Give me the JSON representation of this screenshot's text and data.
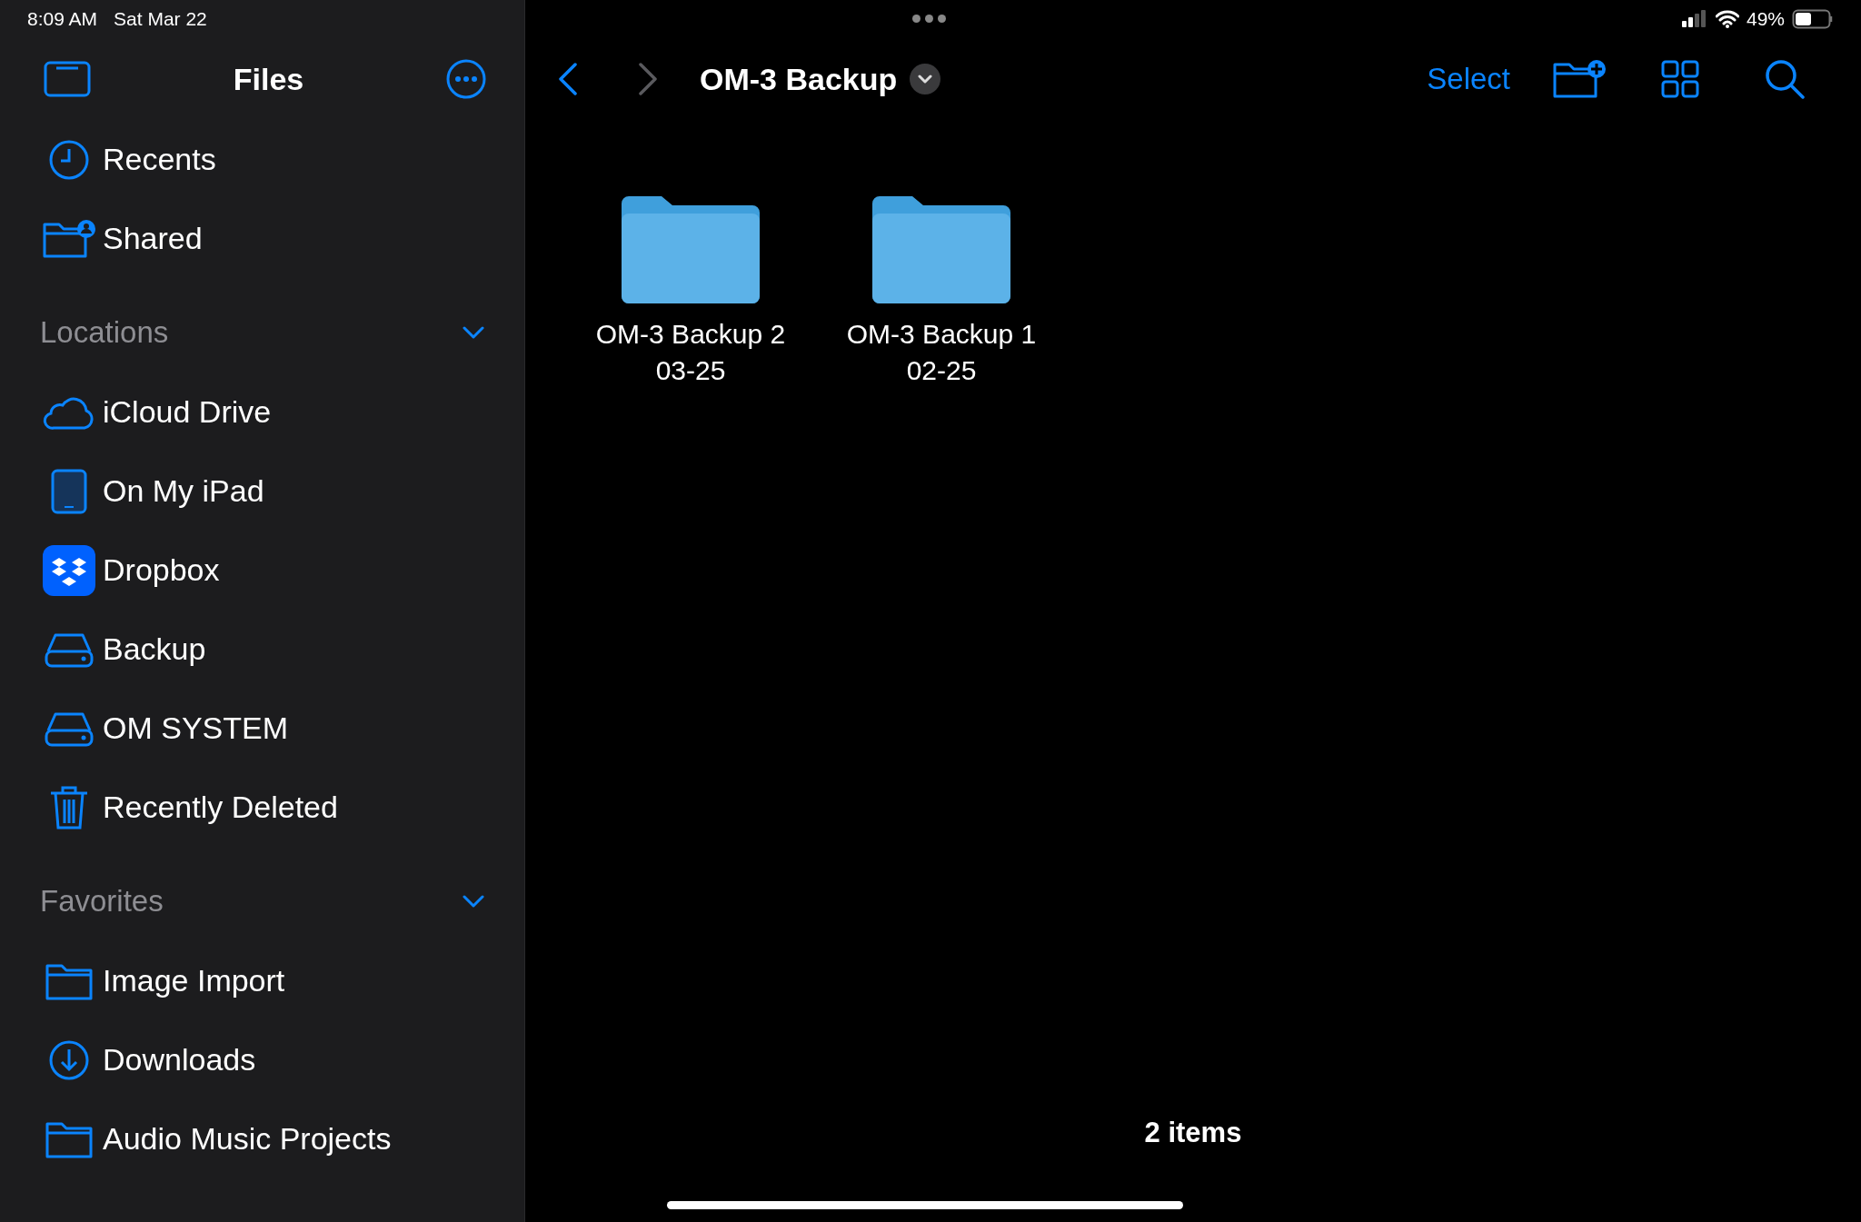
{
  "status_bar": {
    "time": "8:09 AM",
    "date": "Sat Mar 22",
    "battery": "49%"
  },
  "sidebar": {
    "title": "Files",
    "items": [
      {
        "label": "Recents",
        "kind": "clock",
        "selected": false
      },
      {
        "label": "Shared",
        "kind": "shared-folder",
        "selected": false
      }
    ],
    "sections": [
      {
        "title": "Locations",
        "expanded": true,
        "items": [
          {
            "label": "iCloud Drive",
            "kind": "cloud",
            "selected": false
          },
          {
            "label": "On My iPad",
            "kind": "tablet",
            "selected": false
          },
          {
            "label": "Dropbox",
            "kind": "dropbox",
            "selected": false
          },
          {
            "label": "Backup",
            "kind": "drive",
            "selected": false
          },
          {
            "label": "OM SYSTEM",
            "kind": "drive",
            "selected": false
          },
          {
            "label": "Recently Deleted",
            "kind": "trash",
            "selected": false
          }
        ]
      },
      {
        "title": "Favorites",
        "expanded": true,
        "items": [
          {
            "label": "Image Import",
            "kind": "folder",
            "selected": false
          },
          {
            "label": "Downloads",
            "kind": "download",
            "selected": false
          },
          {
            "label": "Audio Music Projects",
            "kind": "folder",
            "selected": false
          }
        ]
      }
    ]
  },
  "toolbar": {
    "back_disabled": false,
    "forward_disabled": true,
    "title": "OM-3 Backup",
    "select": "Select"
  },
  "folders": [
    {
      "name": "OM-3 Backup 2",
      "date": "03-25"
    },
    {
      "name": "OM-3 Backup 1",
      "date": "02-25"
    }
  ],
  "footer": {
    "count": "2 items"
  }
}
